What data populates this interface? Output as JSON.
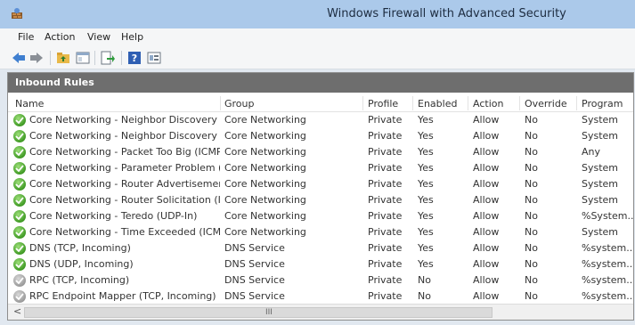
{
  "window": {
    "title": "Windows Firewall with Advanced Security"
  },
  "menu": [
    "File",
    "Action",
    "View",
    "Help"
  ],
  "toolbar": {
    "icons": [
      "back-arrow-icon",
      "forward-arrow-icon",
      "up-folder-icon",
      "show-hide-console-tree-icon",
      "export-list-icon",
      "help-icon",
      "properties-icon"
    ]
  },
  "panel": {
    "title": "Inbound Rules"
  },
  "columns": [
    "Name",
    "Group",
    "Profile",
    "Enabled",
    "Action",
    "Override",
    "Program"
  ],
  "rows": [
    {
      "name": "Core Networking - Neighbor Discovery A...",
      "group": "Core Networking",
      "profile": "Private",
      "enabled": "Yes",
      "action": "Allow",
      "override": "No",
      "program": "System",
      "status": "enabled"
    },
    {
      "name": "Core Networking - Neighbor Discovery S...",
      "group": "Core Networking",
      "profile": "Private",
      "enabled": "Yes",
      "action": "Allow",
      "override": "No",
      "program": "System",
      "status": "enabled"
    },
    {
      "name": "Core Networking - Packet Too Big (ICMP...",
      "group": "Core Networking",
      "profile": "Private",
      "enabled": "Yes",
      "action": "Allow",
      "override": "No",
      "program": "Any",
      "status": "enabled"
    },
    {
      "name": "Core Networking - Parameter Problem (I...",
      "group": "Core Networking",
      "profile": "Private",
      "enabled": "Yes",
      "action": "Allow",
      "override": "No",
      "program": "System",
      "status": "enabled"
    },
    {
      "name": "Core Networking - Router Advertisement...",
      "group": "Core Networking",
      "profile": "Private",
      "enabled": "Yes",
      "action": "Allow",
      "override": "No",
      "program": "System",
      "status": "enabled"
    },
    {
      "name": "Core Networking - Router Solicitation (IC...",
      "group": "Core Networking",
      "profile": "Private",
      "enabled": "Yes",
      "action": "Allow",
      "override": "No",
      "program": "System",
      "status": "enabled"
    },
    {
      "name": "Core Networking - Teredo (UDP-In)",
      "group": "Core Networking",
      "profile": "Private",
      "enabled": "Yes",
      "action": "Allow",
      "override": "No",
      "program": "%System...",
      "status": "enabled"
    },
    {
      "name": "Core Networking - Time Exceeded (ICMP...",
      "group": "Core Networking",
      "profile": "Private",
      "enabled": "Yes",
      "action": "Allow",
      "override": "No",
      "program": "System",
      "status": "enabled"
    },
    {
      "name": "DNS (TCP, Incoming)",
      "group": "DNS Service",
      "profile": "Private",
      "enabled": "Yes",
      "action": "Allow",
      "override": "No",
      "program": "%system...",
      "status": "enabled"
    },
    {
      "name": "DNS (UDP, Incoming)",
      "group": "DNS Service",
      "profile": "Private",
      "enabled": "Yes",
      "action": "Allow",
      "override": "No",
      "program": "%system...",
      "status": "enabled"
    },
    {
      "name": "RPC (TCP, Incoming)",
      "group": "DNS Service",
      "profile": "Private",
      "enabled": "No",
      "action": "Allow",
      "override": "No",
      "program": "%system...",
      "status": "disabled"
    },
    {
      "name": "RPC Endpoint Mapper (TCP, Incoming)",
      "group": "DNS Service",
      "profile": "Private",
      "enabled": "No",
      "action": "Allow",
      "override": "No",
      "program": "%system...",
      "status": "disabled"
    }
  ],
  "scrollbar": {
    "left_arrow": "<",
    "grip": "III"
  }
}
